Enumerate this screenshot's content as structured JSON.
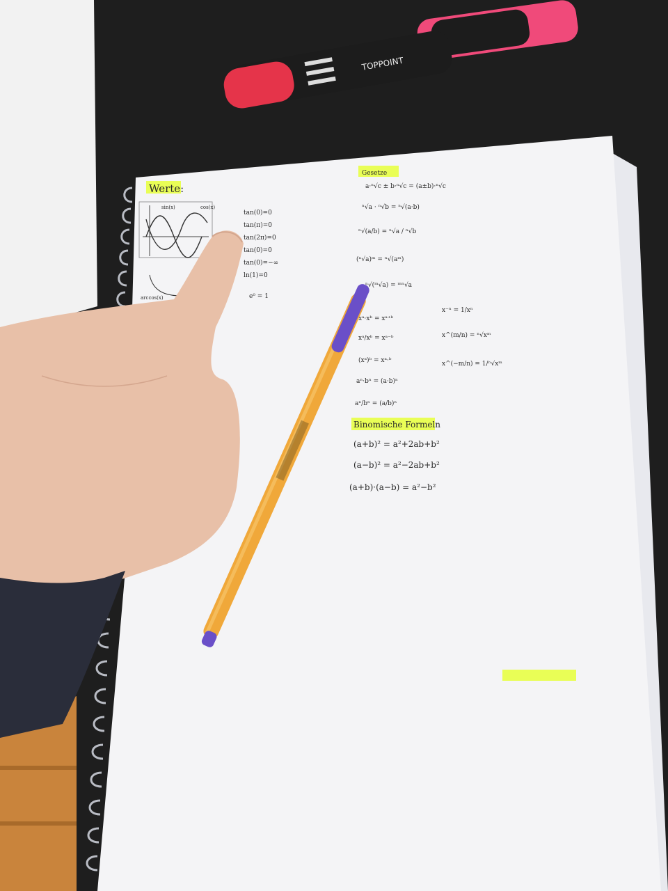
{
  "scene": {
    "description_labels": {
      "werte_heading": "Werte:",
      "gesetze_heading": "Gesetze",
      "binomische_heading": "Binomische Formeln"
    },
    "werte_list": [
      "tan(0)=0",
      "tan(π)=0",
      "tan(2π)=0",
      "tan(0)=0",
      "tan(0)=−∞",
      "ln(1)=0",
      "e⁰ = 1"
    ],
    "graph_labels": [
      "sin(x)",
      "cos(x)",
      "arccos(x)"
    ],
    "gesetze_formulas": [
      "a·ⁿ√c ± b·ⁿ√c = (a±b)·ⁿ√c",
      "ⁿ√a · ⁿ√b = ⁿ√(a·b)",
      "ⁿ√(a/b) = ⁿ√a / ⁿ√b",
      "(ⁿ√a)ᵐ = ⁿ√(aᵐ)",
      "ⁿ√(ᵐ√a) = ᵐⁿ√a",
      "xᵃ·xᵇ = xᵃ⁺ᵇ",
      "xᵃ/xᵇ = xᵃ⁻ᵇ",
      "(xᵃ)ᵇ = xᵃ·ᵇ",
      "aⁿ·bⁿ = (a·b)ⁿ",
      "aⁿ/bⁿ = (a/b)ⁿ"
    ],
    "power_formulas": [
      "x⁻ⁿ = 1/xⁿ",
      "x^(m/n) = ⁿ√xᵐ",
      "x^(−m/n) = 1/ⁿ√xᵐ"
    ],
    "binomische_formulas": [
      "(a+b)² = a²+2ab+b²",
      "(a−b)² = a²−2ab+b²",
      "(a+b)·(a−b) = a²−b²"
    ],
    "marker_brand": "TOPPOINT",
    "colors": {
      "table": "#1e1e1e",
      "paper": "#f4f4f6",
      "highlighter": "#e6ff3a",
      "pen_body": "#f0a83a",
      "pen_cap": "#6a4fc8",
      "marker_red": "#e5344a",
      "marker_pink": "#f04a7a",
      "skin": "#e8c0a8",
      "sleeve": "#2a2d3a"
    }
  }
}
